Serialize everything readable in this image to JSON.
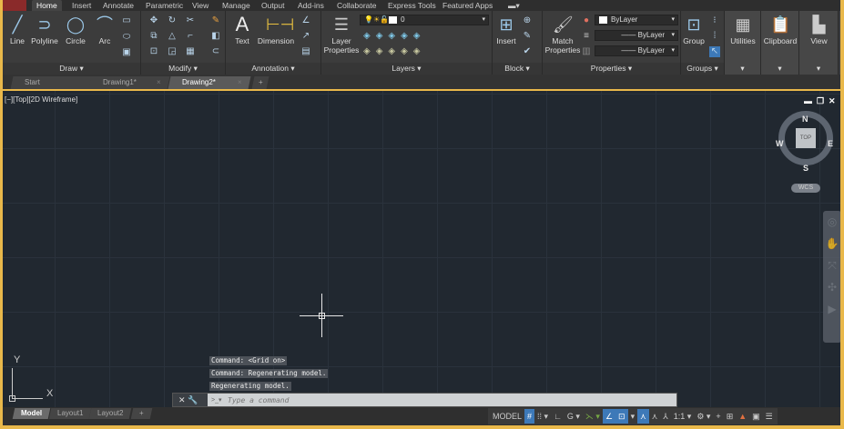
{
  "menu_tabs": [
    "Home",
    "Insert",
    "Annotate",
    "Parametric",
    "View",
    "Manage",
    "Output",
    "Add-ins",
    "Collaborate",
    "Express Tools",
    "Featured Apps"
  ],
  "active_tab": "Home",
  "panels": {
    "draw": {
      "label": "Draw",
      "tools": [
        "Line",
        "Polyline",
        "Circle",
        "Arc"
      ]
    },
    "modify": {
      "label": "Modify"
    },
    "annotation": {
      "label": "Annotation",
      "tools": [
        "Text",
        "Dimension"
      ]
    },
    "layers": {
      "label": "Layers",
      "layer_properties": "Layer Properties",
      "current_layer": "0"
    },
    "block": {
      "label": "Block",
      "insert": "Insert"
    },
    "properties": {
      "label": "Properties",
      "match": "Match Properties",
      "color": "ByLayer",
      "linetype": "ByLayer",
      "lineweight": "ByLayer"
    },
    "groups": {
      "label": "Groups",
      "group": "Group"
    },
    "utilities": {
      "label": "Utilities"
    },
    "clipboard": {
      "label": "Clipboard"
    },
    "view": {
      "label": "View"
    }
  },
  "doc_tabs": [
    "Start",
    "Drawing1*",
    "Drawing2*"
  ],
  "active_doc": "Drawing2*",
  "viewport_label": "[−][Top][2D Wireframe]",
  "viewcube": {
    "top": "TOP",
    "n": "N",
    "s": "S",
    "e": "E",
    "w": "W",
    "wcs": "WCS"
  },
  "ucs": {
    "x": "X",
    "y": "Y"
  },
  "command_history": [
    "Command:  <Grid on>",
    "Command: Regenerating model.",
    "Regenerating model."
  ],
  "command_placeholder": "Type a command",
  "layout_tabs": [
    "Model",
    "Layout1",
    "Layout2"
  ],
  "status": {
    "model": "MODEL",
    "scale": "1:1"
  },
  "colors": {
    "accent": "#e9b84a",
    "canvas": "#212830",
    "ribbon": "#3c3c3c"
  }
}
